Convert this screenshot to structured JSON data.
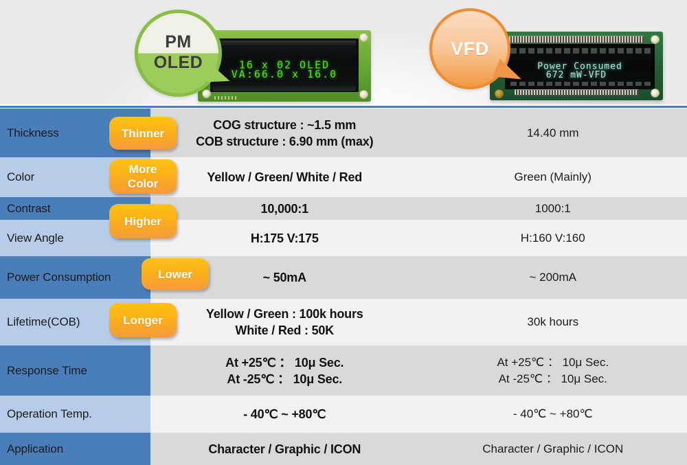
{
  "header": {
    "oled": {
      "bubble_label": "PM\nOLED",
      "display_line1": "16 x 02 OLED",
      "display_line2": "VA:66.0 x 16.0"
    },
    "vfd": {
      "bubble_label": "VFD",
      "display_line1": "Power Consumed",
      "display_line2": "672 mW-VFD"
    }
  },
  "colors": {
    "label_dark": "#4a7ebb",
    "label_light": "#b6cce9",
    "value_dark": "#d9d9d9",
    "value_light": "#f2f2f2",
    "badge_top": "#fdc217",
    "badge_bottom": "#f79a3c",
    "accent_rule": "#4a7ebb",
    "oled_green": "#55e01c",
    "vfd_cyan": "#a9ecdf"
  },
  "rows": [
    {
      "label": "Thickness",
      "oled": "COG structure : ~1.5 mm\nCOB structure  :  6.90 mm (max)",
      "vfd": "14.40 mm"
    },
    {
      "label": "Color",
      "oled": "Yellow / Green/ White / Red",
      "vfd": "Green (Mainly)"
    },
    {
      "label": "Contrast",
      "oled": "10,000:1",
      "vfd": "1000:1"
    },
    {
      "label": "View Angle",
      "oled": "H:175   V:175",
      "vfd": "H:160   V:160"
    },
    {
      "label": "Power Consumption",
      "oled": "~ 50mA",
      "vfd": "~ 200mA"
    },
    {
      "label": "Lifetime(COB)",
      "oled": "Yellow / Green : 100k hours\nWhite / Red : 50K",
      "vfd": "30k hours"
    },
    {
      "label": "Response Time",
      "oled": "At +25℃ ： 10μ Sec.\nAt -25℃ ： 10μ Sec.",
      "vfd": "At +25℃ ： 10μ Sec.\nAt  -25℃ ： 10μ Sec."
    },
    {
      "label": "Operation Temp.",
      "oled": "- 40℃ ~ +80℃",
      "vfd": "- 40℃ ~ +80℃"
    },
    {
      "label": "Application",
      "oled": "Character / Graphic / ICON",
      "vfd": "Character / Graphic / ICON"
    }
  ],
  "badges": [
    {
      "text": "Thinner"
    },
    {
      "text": "More\nColor"
    },
    {
      "text": "Higher"
    },
    {
      "text": "Lower"
    },
    {
      "text": "Longer"
    }
  ]
}
